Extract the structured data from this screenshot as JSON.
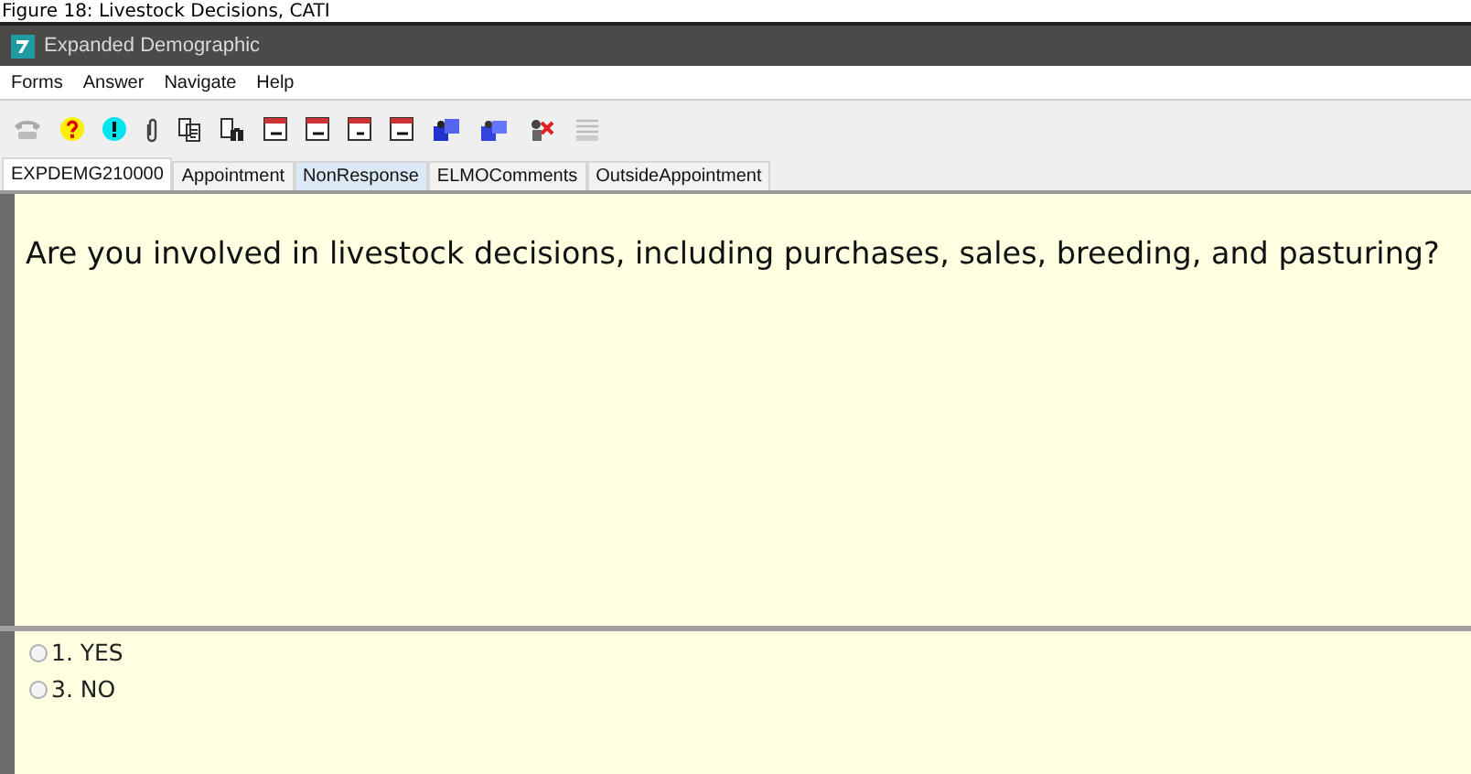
{
  "caption": "Figure 18: Livestock Decisions, CATI",
  "window": {
    "title": "Expanded Demographic"
  },
  "menu": [
    "Forms",
    "Answer",
    "Navigate",
    "Help"
  ],
  "tabs": [
    {
      "label": "EXPDEMG210000",
      "selected": true,
      "hovered": false
    },
    {
      "label": "Appointment",
      "selected": false,
      "hovered": false
    },
    {
      "label": "NonResponse",
      "selected": false,
      "hovered": true
    },
    {
      "label": "ELMOComments",
      "selected": false,
      "hovered": false
    },
    {
      "label": "OutsideAppointment",
      "selected": false,
      "hovered": false
    }
  ],
  "question": "Are you involved in livestock decisions, including purchases, sales, breeding, and pasturing?",
  "answers": [
    {
      "label": "1. YES",
      "selected": false
    },
    {
      "label": "3. NO",
      "selected": false
    }
  ]
}
